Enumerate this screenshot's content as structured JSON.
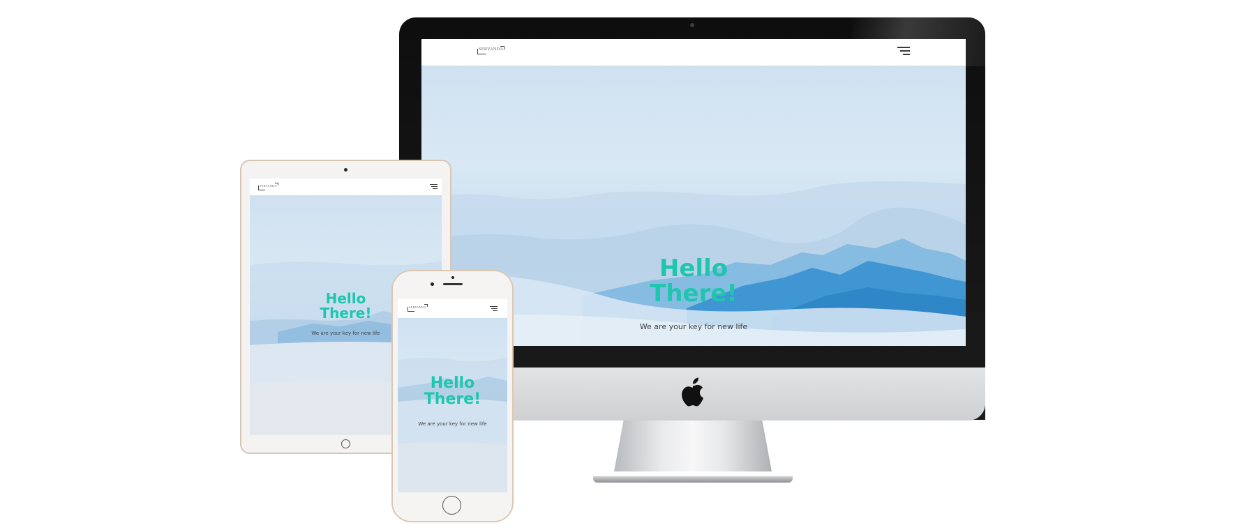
{
  "site": {
    "logo_text": "SERVANDA",
    "hero_title_line1": "Hello",
    "hero_title_line2": "There!",
    "hero_subtitle": "We are your key for new life"
  },
  "colors": {
    "accent": "#1ec6ae",
    "sky": "#d4e5f3",
    "mountain": "#4a9fd6",
    "device_frame_dark": "#111111",
    "device_frame_gold": "#dcc8b2"
  },
  "icons": {
    "menu": "hamburger-menu-icon",
    "brand": "apple-logo-icon"
  }
}
